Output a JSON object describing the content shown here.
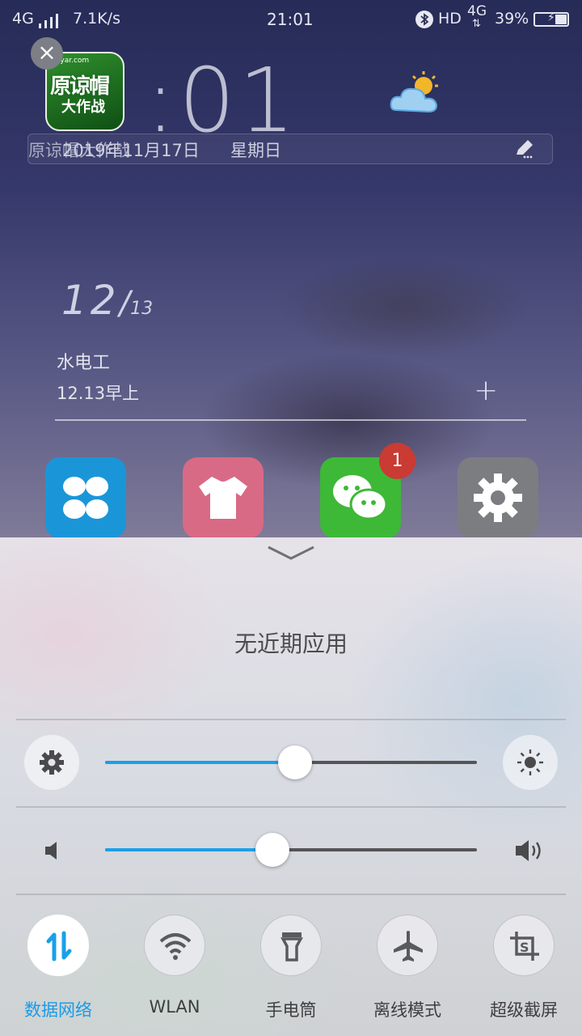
{
  "status_bar": {
    "network": "4G",
    "speed": "7.1K/s",
    "time": "21:01",
    "hd": "HD",
    "network2": "4G",
    "battery": "39%"
  },
  "home": {
    "clock": ":01",
    "game_icon": {
      "line1": "原谅帽",
      "line2": "大作战",
      "small": "Ssyar.com",
      "label": "原谅帽大作战"
    },
    "date": "2019年11月17日",
    "weekday": "星期日",
    "widget": {
      "day": "12",
      "month": "13",
      "title": "水电工",
      "subtitle": "12.13早上"
    },
    "badge": "1"
  },
  "panel": {
    "no_recent": "无近期应用",
    "brightness": {
      "level": 0.51
    },
    "volume": {
      "level": 0.45
    },
    "toggles": [
      {
        "label": "数据网络",
        "active": true,
        "icon": "data-network-icon"
      },
      {
        "label": "WLAN",
        "active": false,
        "icon": "wifi-icon"
      },
      {
        "label": "手电筒",
        "active": false,
        "icon": "flashlight-icon"
      },
      {
        "label": "离线模式",
        "active": false,
        "icon": "airplane-icon"
      },
      {
        "label": "超级截屏",
        "active": false,
        "icon": "screenshot-icon"
      }
    ]
  },
  "colors": {
    "accent": "#1aa0e8",
    "badge": "#c93b33"
  }
}
